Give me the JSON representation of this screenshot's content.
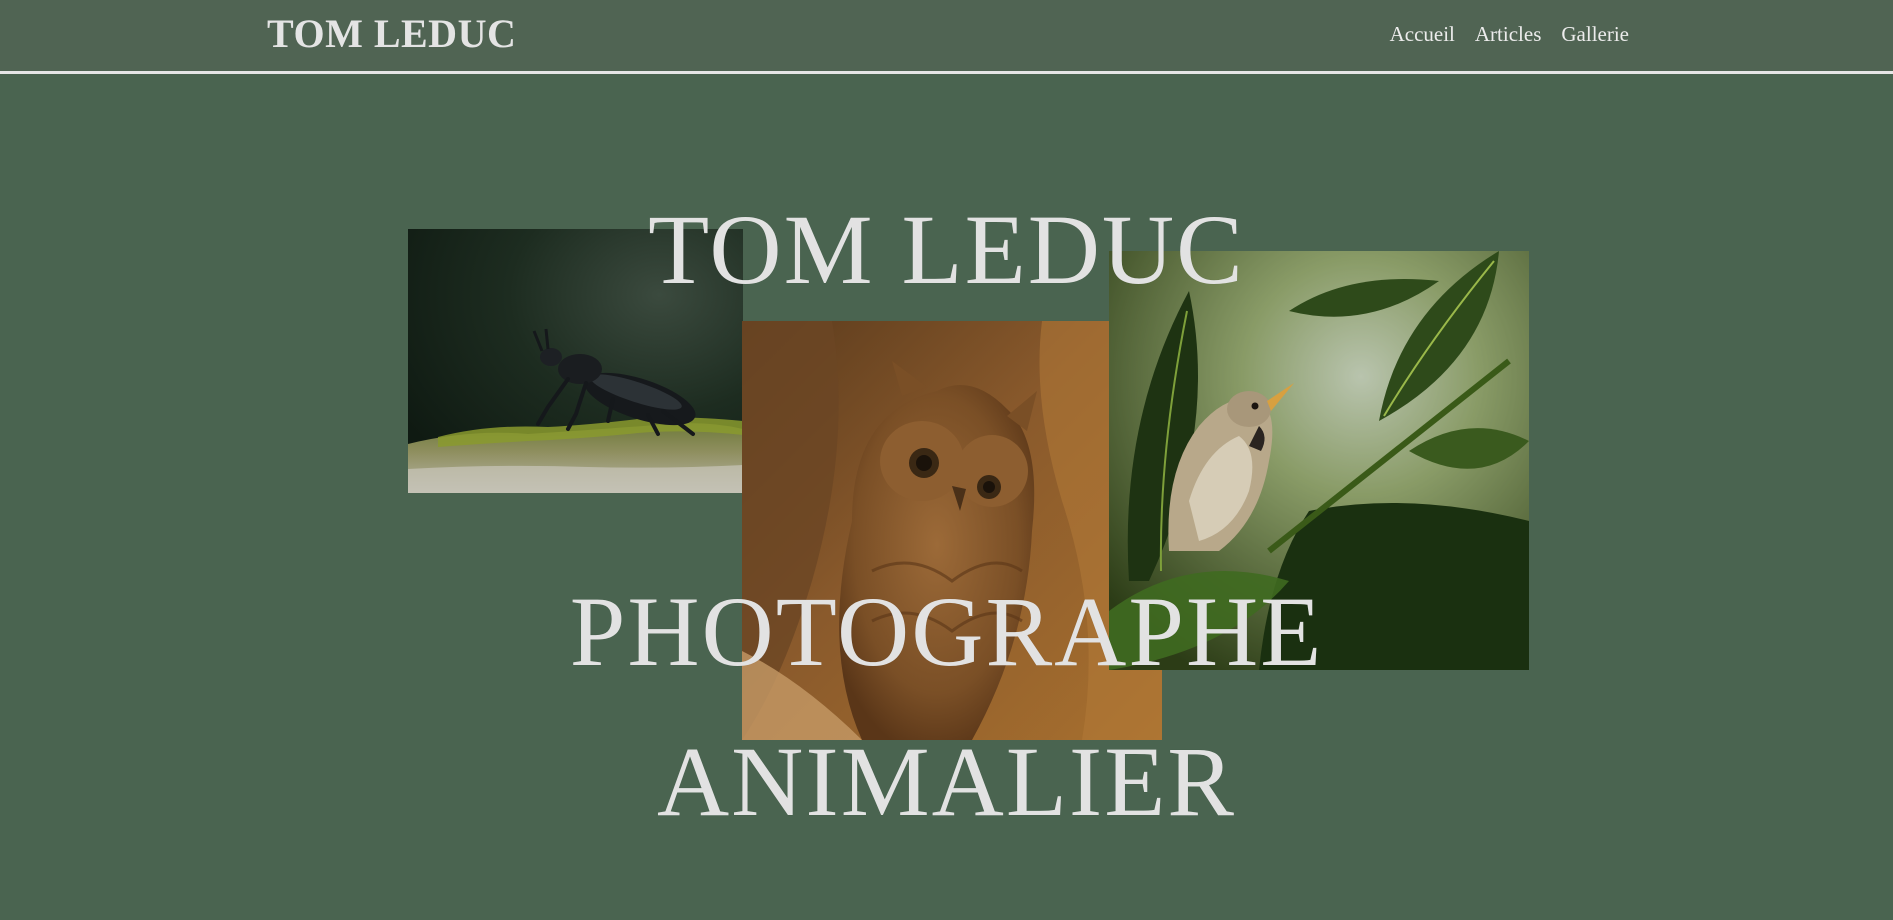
{
  "header": {
    "brand": "TOM LEDUC",
    "nav": [
      {
        "label": "Accueil"
      },
      {
        "label": "Articles"
      },
      {
        "label": "Gallerie"
      }
    ]
  },
  "hero": {
    "line1": "TOM LEDUC",
    "line2": "PHOTOGRAPHE",
    "line3": "ANIMALIER"
  },
  "colors": {
    "header_bg": "#506453",
    "page_bg": "#4a6450",
    "text": "#e2e2e2",
    "divider": "#e6e6e6"
  }
}
